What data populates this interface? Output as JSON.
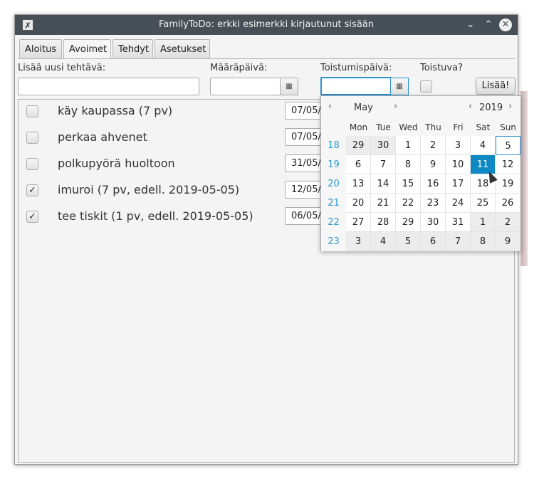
{
  "window": {
    "title": "FamilyToDo: erkki esimerkki kirjautunut sisään",
    "icon": "x-app-icon",
    "controls": {
      "minimize": "⌄",
      "maximize": "⌃",
      "close": "✕"
    }
  },
  "tabs": [
    {
      "label": "Aloitus",
      "active": false
    },
    {
      "label": "Avoimet",
      "active": true
    },
    {
      "label": "Tehdyt",
      "active": false
    },
    {
      "label": "Asetukset",
      "active": false
    }
  ],
  "form": {
    "new_task_label": "Lisää uusi tehtävä:",
    "new_task_value": "",
    "due_label": "Määräpäivä:",
    "due_value": "",
    "repeat_date_label": "Toistumispäivä:",
    "repeat_date_value": "",
    "repeating_label": "Toistuva?",
    "repeating_checked": false,
    "add_button": "Lisää!",
    "calendar_icon": "calendar-icon"
  },
  "tasks": [
    {
      "name": "käy kaupassa (7 pv)",
      "checked": false,
      "date": "07/05/2019"
    },
    {
      "name": "perkaa ahvenet",
      "checked": false,
      "date": "07/05/2019"
    },
    {
      "name": "polkupyörä huoltoon",
      "checked": false,
      "date": "31/05/2019"
    },
    {
      "name": "imuroi (7 pv, edell. 2019-05-05)",
      "checked": true,
      "date": "12/05/2019"
    },
    {
      "name": "tee tiskit (1 pv, edell. 2019-05-05)",
      "checked": true,
      "date": "06/05/2019"
    }
  ],
  "calendar": {
    "month": "May",
    "year": "2019",
    "prev": "‹",
    "next": "›",
    "weekdays": [
      "Mon",
      "Tue",
      "Wed",
      "Thu",
      "Fri",
      "Sat",
      "Sun"
    ],
    "weeks": [
      {
        "week": "18",
        "days": [
          "29",
          "30",
          "1",
          "2",
          "3",
          "4",
          "5"
        ],
        "other": [
          true,
          true,
          false,
          false,
          false,
          false,
          false
        ]
      },
      {
        "week": "19",
        "days": [
          "6",
          "7",
          "8",
          "9",
          "10",
          "11",
          "12"
        ],
        "other": [
          false,
          false,
          false,
          false,
          false,
          false,
          false
        ]
      },
      {
        "week": "20",
        "days": [
          "13",
          "14",
          "15",
          "16",
          "17",
          "18",
          "19"
        ],
        "other": [
          false,
          false,
          false,
          false,
          false,
          false,
          false
        ]
      },
      {
        "week": "21",
        "days": [
          "20",
          "21",
          "22",
          "23",
          "24",
          "25",
          "26"
        ],
        "other": [
          false,
          false,
          false,
          false,
          false,
          false,
          false
        ]
      },
      {
        "week": "22",
        "days": [
          "27",
          "28",
          "29",
          "30",
          "31",
          "1",
          "2"
        ],
        "other": [
          false,
          false,
          false,
          false,
          false,
          true,
          true
        ]
      },
      {
        "week": "23",
        "days": [
          "3",
          "4",
          "5",
          "6",
          "7",
          "8",
          "9"
        ],
        "other": [
          true,
          true,
          true,
          true,
          true,
          true,
          true
        ]
      }
    ],
    "selected_day": "11",
    "today_day": "5"
  }
}
